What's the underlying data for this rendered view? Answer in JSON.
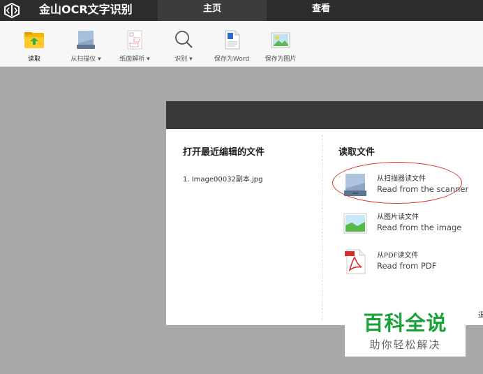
{
  "app": {
    "title": "金山OCR文字识别"
  },
  "tabs": [
    {
      "label": "主页",
      "active": true
    },
    {
      "label": "查看",
      "active": false
    }
  ],
  "toolbar": {
    "read": "读取",
    "from_scanner": "从扫描仪",
    "page_parse": "纸面解析",
    "recognize": "识别",
    "save_word": "保存为Word",
    "save_image": "保存为图片"
  },
  "dialog": {
    "recent_title": "打开最近编辑的文件",
    "recent_files": [
      "1. Image00032副本.jpg"
    ],
    "read_title": "读取文件",
    "sources": [
      {
        "cn": "从扫描器读文件",
        "en": "Read from the scanner",
        "icon": "scanner-icon"
      },
      {
        "cn": "从图片读文件",
        "en": "Read from the image",
        "icon": "image-icon"
      },
      {
        "cn": "从PDF读文件",
        "en": "Read from PDF",
        "icon": "pdf-icon"
      }
    ],
    "cut_char": "退"
  },
  "watermark": {
    "main": "百科全说",
    "sub": "助你轻松解决"
  },
  "colors": {
    "titlebar": "#2c2c2c",
    "annotation": "#d9302c",
    "watermark_green": "#1aa23a"
  }
}
